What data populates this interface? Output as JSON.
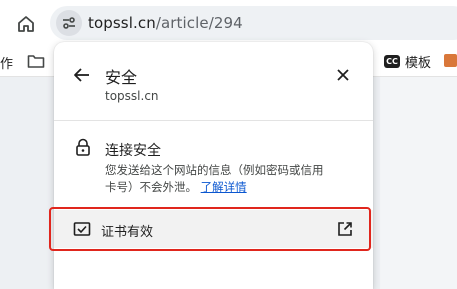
{
  "browser": {
    "url_host": "topssl.cn",
    "url_path": "/article/294",
    "home_icon": "home-icon",
    "site_info_icon": "tune-icon"
  },
  "bookmarks": {
    "left_partial_text": "作",
    "folder_icon": "folder-icon",
    "template_badge": "CC",
    "template_label": "模板"
  },
  "popup": {
    "title": "安全",
    "host": "topssl.cn",
    "security": {
      "title": "连接安全",
      "description": "您发送给这个网站的信息（例如密码或信用卡号）不会外泄。",
      "link": "了解详情"
    },
    "certificate": {
      "label": "证书有效"
    }
  },
  "colors": {
    "link": "#0b57d0",
    "highlight": "#e0261d",
    "row_bg": "#f2f2f2"
  }
}
